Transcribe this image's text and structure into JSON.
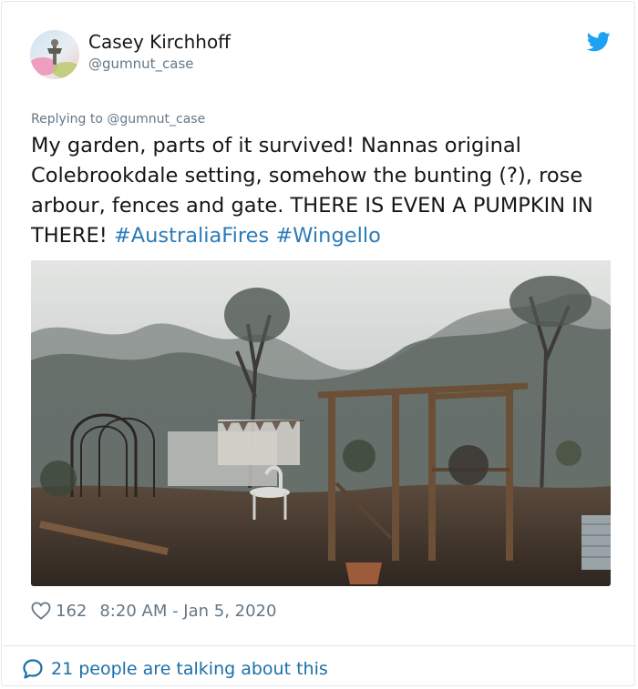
{
  "author": {
    "name": "Casey Kirchhoff",
    "handle": "@gumnut_case"
  },
  "reply_to": "Replying to @gumnut_case",
  "tweet": {
    "text": "My garden, parts of it survived! Nannas original Colebrookdale setting, somehow the bunting (?), rose arbour, fences and gate. THERE IS EVEN A PUMPKIN IN THERE! ",
    "hashtags": [
      "#AustraliaFires",
      "#Wingello"
    ]
  },
  "stats": {
    "likes": "162",
    "timestamp": "8:20 AM - Jan 5, 2020"
  },
  "footer": {
    "talking": "21 people are talking about this"
  },
  "icons": {
    "logo": "twitter-bird-icon",
    "like": "heart-icon",
    "reply": "speech-bubble-icon"
  },
  "colors": {
    "brand_blue": "#1da1f2",
    "hashtag": "#2b7bb9",
    "secondary_text": "#657786",
    "primary_text": "#14171a"
  }
}
